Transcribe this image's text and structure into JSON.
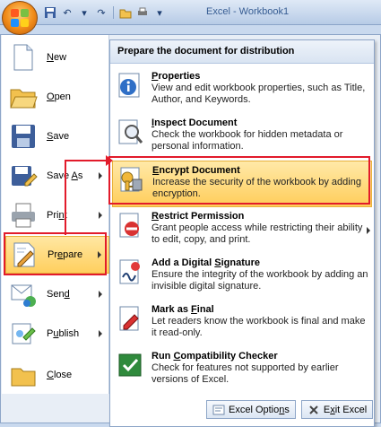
{
  "window": {
    "title_fragment": "Excel - Workbook1"
  },
  "left_menu": [
    {
      "label_pre": "",
      "label_u": "N",
      "label_post": "ew",
      "icon": "new-document-icon",
      "has_arrow": false
    },
    {
      "label_pre": "",
      "label_u": "O",
      "label_post": "pen",
      "icon": "open-folder-icon",
      "has_arrow": false
    },
    {
      "label_pre": "",
      "label_u": "S",
      "label_post": "ave",
      "icon": "save-disk-icon",
      "has_arrow": false
    },
    {
      "label_pre": "Save ",
      "label_u": "A",
      "label_post": "s",
      "icon": "save-as-icon",
      "has_arrow": true
    },
    {
      "label_pre": "Pri",
      "label_u": "n",
      "label_post": "t",
      "icon": "printer-icon",
      "has_arrow": true
    },
    {
      "label_pre": "Pr",
      "label_u": "e",
      "label_post": "pare",
      "icon": "prepare-pen-icon",
      "has_arrow": true
    },
    {
      "label_pre": "Sen",
      "label_u": "d",
      "label_post": "",
      "icon": "send-icon",
      "has_arrow": true
    },
    {
      "label_pre": "P",
      "label_u": "u",
      "label_post": "blish",
      "icon": "publish-icon",
      "has_arrow": true
    },
    {
      "label_pre": "",
      "label_u": "C",
      "label_post": "lose",
      "icon": "close-folder-icon",
      "has_arrow": false
    }
  ],
  "submenu": {
    "header": "Prepare the document for distribution",
    "items": [
      {
        "title_pre": "",
        "title_u": "P",
        "title_post": "roperties",
        "desc": "View and edit workbook properties, such as Title, Author, and Keywords.",
        "icon": "properties-icon"
      },
      {
        "title_pre": "",
        "title_u": "I",
        "title_post": "nspect Document",
        "desc": "Check the workbook for hidden metadata or personal information.",
        "icon": "inspect-document-icon"
      },
      {
        "title_pre": "",
        "title_u": "E",
        "title_post": "ncrypt Document",
        "desc": "Increase the security of the workbook by adding encryption.",
        "icon": "encrypt-key-icon"
      },
      {
        "title_pre": "",
        "title_u": "R",
        "title_post": "estrict Permission",
        "desc": "Grant people access while restricting their ability to edit, copy, and print.",
        "icon": "restrict-permission-icon"
      },
      {
        "title_pre": "Add a Digital ",
        "title_u": "S",
        "title_post": "ignature",
        "desc": "Ensure the integrity of the workbook by adding an invisible digital signature.",
        "icon": "digital-signature-icon"
      },
      {
        "title_pre": "Mark as ",
        "title_u": "F",
        "title_post": "inal",
        "desc": "Let readers know the workbook is final and make it read-only.",
        "icon": "mark-final-icon"
      },
      {
        "title_pre": "Run ",
        "title_u": "C",
        "title_post": "ompatibility Checker",
        "desc": "Check for features not supported by earlier versions of Excel.",
        "icon": "compatibility-checker-icon"
      }
    ]
  },
  "footer": {
    "options_pre": "Excel Optio",
    "options_u": "n",
    "options_post": "s",
    "exit_pre": "E",
    "exit_u": "x",
    "exit_post": "it Excel"
  },
  "colors": {
    "highlight": "#ffcf5e",
    "annotation_red": "#e21b2b"
  }
}
